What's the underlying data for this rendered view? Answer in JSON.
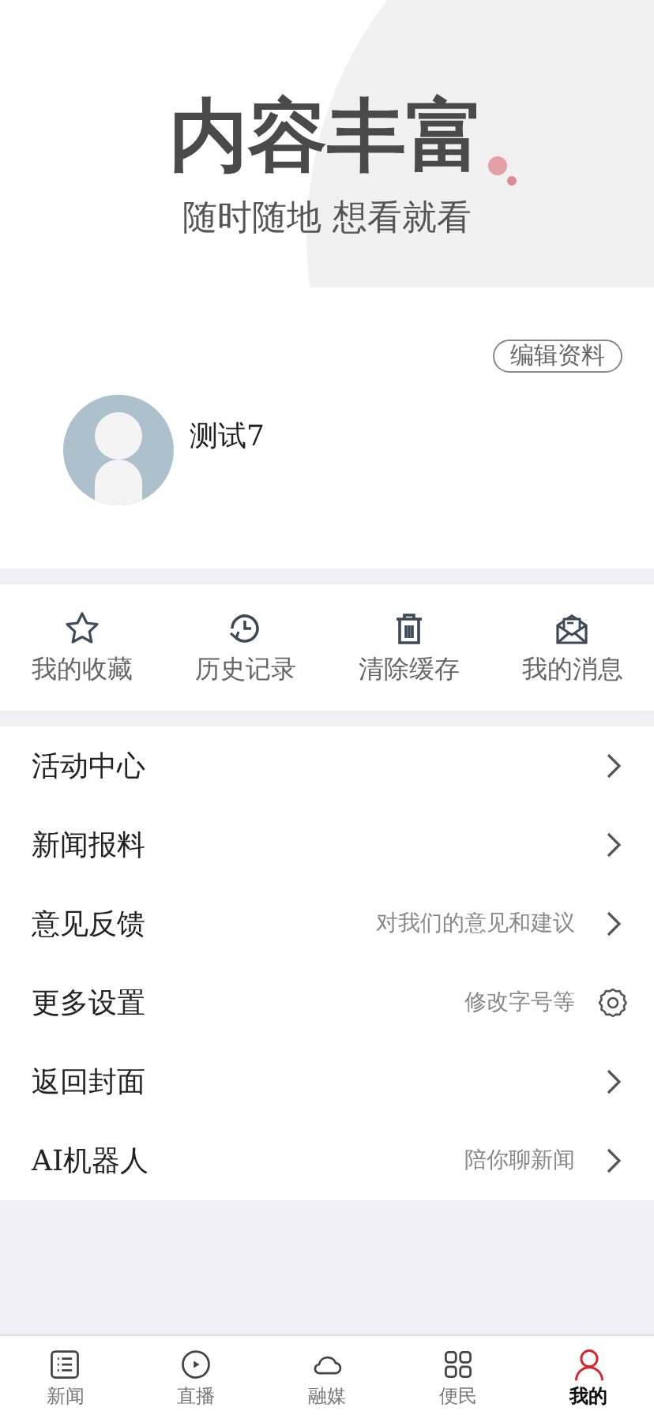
{
  "banner": {
    "title": "内容丰富",
    "subtitle": "随时随地 想看就看"
  },
  "profile": {
    "edit_button": "编辑资料",
    "username": "测试7"
  },
  "quick_actions": [
    {
      "kind": "star",
      "label": "我的收藏"
    },
    {
      "kind": "history",
      "label": "历史记录"
    },
    {
      "kind": "trash",
      "label": "清除缓存"
    },
    {
      "kind": "mail",
      "label": "我的消息"
    }
  ],
  "menu": [
    {
      "title": "活动中心",
      "kind": "chevron"
    },
    {
      "title": "新闻报料",
      "kind": "chevron"
    },
    {
      "title": "意见反馈",
      "hint": "对我们的意见和建议",
      "kind": "chevron"
    },
    {
      "title": "更多设置",
      "hint": "修改字号等",
      "kind": "gear"
    },
    {
      "title": "返回封面",
      "kind": "chevron"
    },
    {
      "title": "AI机器人",
      "hint": "陪你聊新闻",
      "kind": "chevron"
    }
  ],
  "tab_bar": [
    {
      "kind": "list",
      "label": "新闻",
      "selected": false
    },
    {
      "kind": "play",
      "label": "直播",
      "selected": false
    },
    {
      "kind": "cloud",
      "label": "融媒",
      "selected": false
    },
    {
      "kind": "grid",
      "label": "便民",
      "selected": false
    },
    {
      "kind": "person",
      "label": "我的",
      "selected": true
    }
  ]
}
